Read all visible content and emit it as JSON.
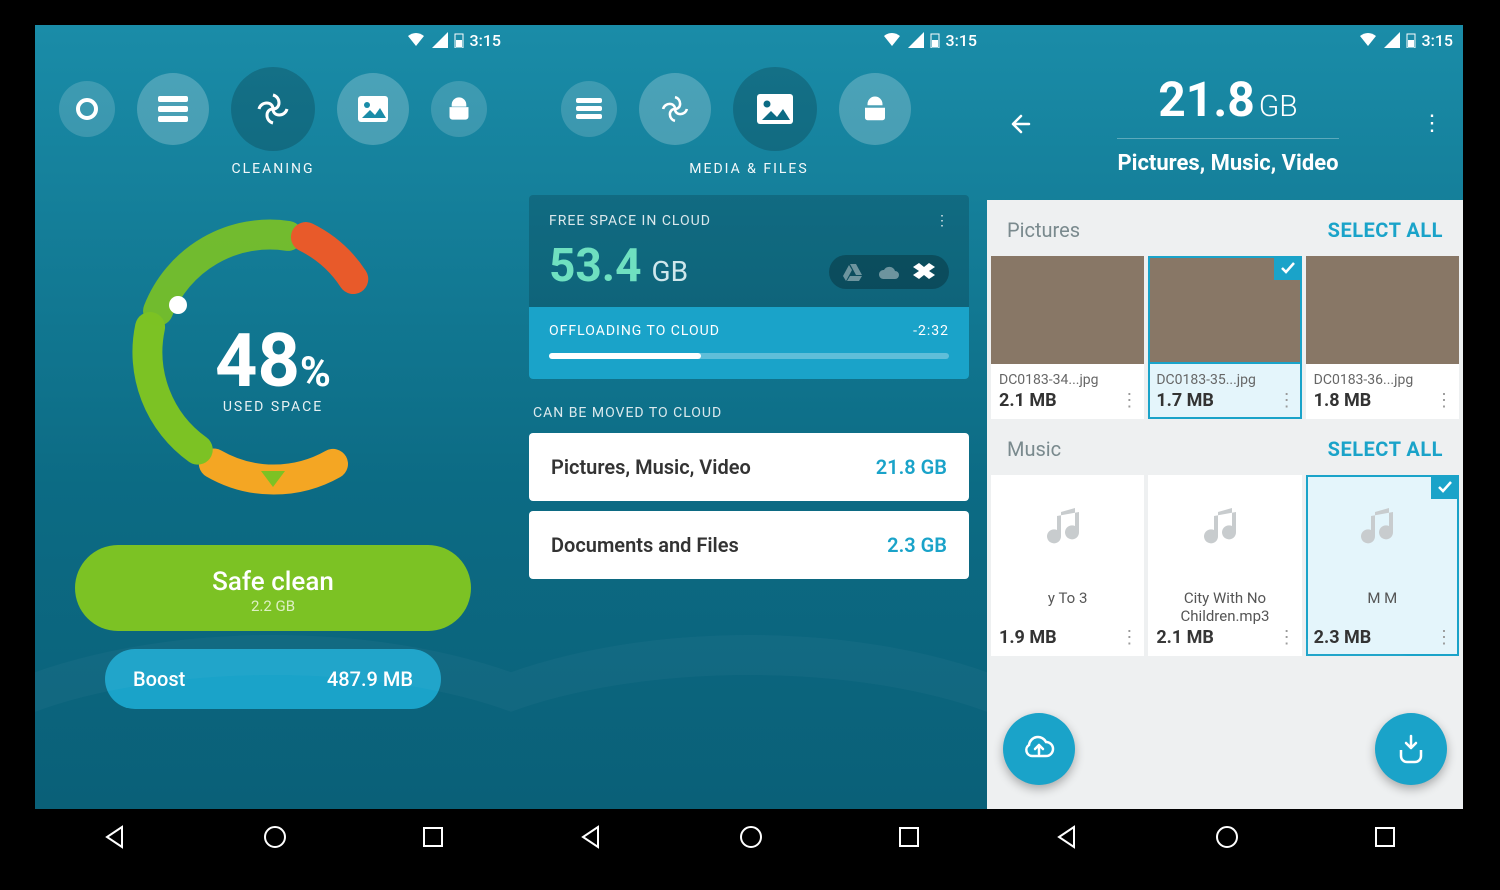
{
  "status": {
    "time": "3:15"
  },
  "screen1": {
    "tabLabel": "CLEANING",
    "percent": "48",
    "percentSymbol": "%",
    "usedLabel": "USED SPACE",
    "clean": {
      "label": "Safe clean",
      "sub": "2.2 GB"
    },
    "boost": {
      "label": "Boost",
      "value": "487.9 MB"
    }
  },
  "screen2": {
    "tabLabel": "MEDIA & FILES",
    "freeLabel": "FREE SPACE IN CLOUD",
    "freeValue": "53.4",
    "freeUnit": "GB",
    "offloadLabel": "OFFLOADING TO CLOUD",
    "offloadTime": "-2:32",
    "moveLabel": "CAN BE MOVED TO CLOUD",
    "rows": [
      {
        "label": "Pictures, Music, Video",
        "value": "21.8 GB"
      },
      {
        "label": "Documents and Files",
        "value": "2.3 GB"
      }
    ]
  },
  "screen3": {
    "totalValue": "21.8",
    "totalUnit": "GB",
    "subtitle": "Pictures, Music, Video",
    "selectAll": "SELECT ALL",
    "cat1": "Pictures",
    "cat2": "Music",
    "pictures": [
      {
        "name": "DC0183-34...jpg",
        "size": "2.1 MB",
        "selected": false
      },
      {
        "name": "DC0183-35...jpg",
        "size": "1.7 MB",
        "selected": true
      },
      {
        "name": "DC0183-36...jpg",
        "size": "1.8 MB",
        "selected": false
      }
    ],
    "music": [
      {
        "name": "y To 3",
        "size": "1.9 MB",
        "selected": false
      },
      {
        "name": "City With No Children.mp3",
        "size": "2.1 MB",
        "selected": false
      },
      {
        "name": "M M",
        "size": "2.3 MB",
        "selected": true
      }
    ]
  }
}
